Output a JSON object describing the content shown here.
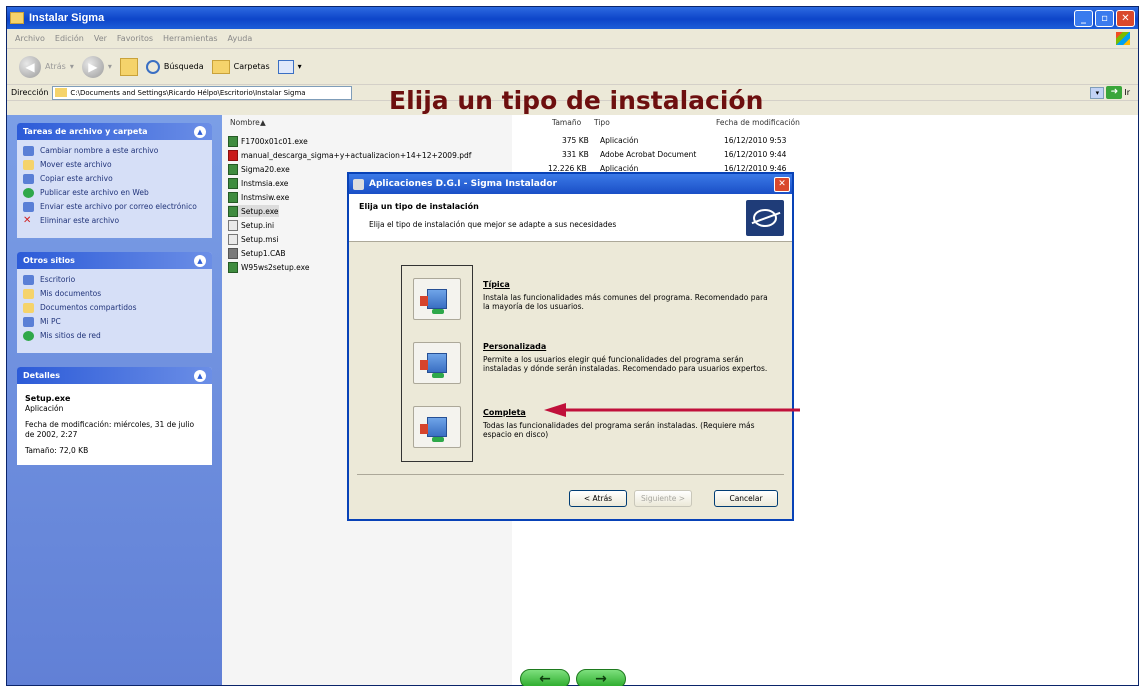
{
  "window": {
    "title": "Instalar Sigma"
  },
  "menu": [
    "Archivo",
    "Edición",
    "Ver",
    "Favoritos",
    "Herramientas",
    "Ayuda"
  ],
  "toolbar": {
    "back": "Atrás",
    "search": "Búsqueda",
    "folders": "Carpetas"
  },
  "address": {
    "label": "Dirección",
    "path": "C:\\Documents and Settings\\Ricardo Hélpo\\Escritorio\\Instalar Sigma",
    "go": "Ir"
  },
  "overlay_title": "Elija un tipo de instalación",
  "taskpane": {
    "tasks_header": "Tareas de archivo y carpeta",
    "tasks": [
      "Cambiar nombre a este archivo",
      "Mover este archivo",
      "Copiar este archivo",
      "Publicar este archivo en Web",
      "Enviar este archivo por correo electrónico",
      "Eliminar este archivo"
    ],
    "other_header": "Otros sitios",
    "other": [
      "Escritorio",
      "Mis documentos",
      "Documentos compartidos",
      "Mi PC",
      "Mis sitios de red"
    ],
    "details_header": "Detalles",
    "details": {
      "name": "Setup.exe",
      "type": "Aplicación",
      "modified": "Fecha de modificación: miércoles, 31 de julio de 2002, 2:27",
      "size": "Tamaño: 72,0 KB"
    }
  },
  "files": {
    "headers": {
      "name": "Nombre",
      "size": "Tamaño",
      "type": "Tipo",
      "date": "Fecha de modificación"
    },
    "rows": [
      {
        "name": "F1700x01c01.exe",
        "size": "375 KB",
        "type": "Aplicación",
        "date": "16/12/2010 9:53"
      },
      {
        "name": "manual_descarga_sigma+y+actualizacion+14+12+2009.pdf",
        "size": "331 KB",
        "type": "Adobe Acrobat Document",
        "date": "16/12/2010 9:44"
      },
      {
        "name": "Sigma20.exe",
        "size": "12.226 KB",
        "type": "Aplicación",
        "date": "16/12/2010 9:46"
      },
      {
        "name": "Instmsia.exe"
      },
      {
        "name": "Instmsiw.exe"
      },
      {
        "name": "Setup.exe"
      },
      {
        "name": "Setup.ini"
      },
      {
        "name": "Setup.msi"
      },
      {
        "name": "Setup1.CAB"
      },
      {
        "name": "W95ws2setup.exe"
      }
    ]
  },
  "dialog": {
    "title": "Aplicaciones D.G.I - Sigma Instalador",
    "header_title": "Elija un tipo de instalación",
    "header_sub": "Elija el tipo de instalación que mejor se adapte a sus necesidades",
    "options": [
      {
        "title": "Típica",
        "desc": "Instala las funcionalidades más comunes del programa. Recomendado para la mayoría de los usuarios."
      },
      {
        "title": "Personalizada",
        "desc": "Permite a los usuarios elegir qué funcionalidades del programa serán instaladas y dónde serán instaladas. Recomendado para usuarios expertos."
      },
      {
        "title": "Completa",
        "desc": "Todas las funcionalidades del programa serán instaladas. (Requiere más espacio en disco)"
      }
    ],
    "back": "< Atrás",
    "next": "Siguiente >",
    "cancel": "Cancelar"
  },
  "nav": {
    "prev": "←",
    "next": "→"
  },
  "colors": {
    "annotation_arrow": "#c0103a",
    "title_text": "#6d0f0f"
  }
}
